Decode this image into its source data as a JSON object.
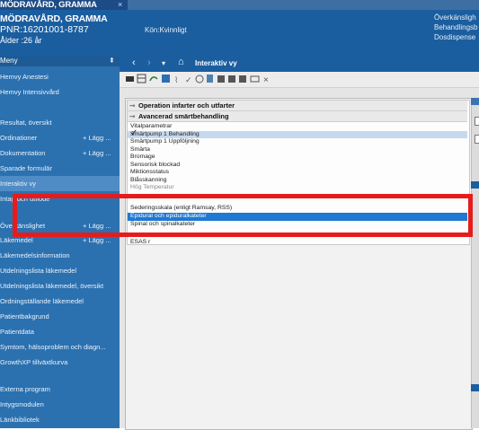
{
  "tab": {
    "title": "MÖDRAVÅRD, GRAMMA",
    "close": "×"
  },
  "patient": {
    "name": "MÖDRAVÅRD, GRAMMA",
    "pnr": "PNR:16201001-8787",
    "age": "Ålder :26 år",
    "gender": "Kön:Kvinnligt",
    "right_labels": [
      "Överkänsligh",
      "Behandlingsb",
      "Dosdispense"
    ]
  },
  "sidebar": {
    "title": "Meny",
    "pin": "⇞",
    "items": [
      {
        "label": "Hemvy Anestesi",
        "add": ""
      },
      {
        "label": "Hemvy Intensivvård",
        "add": ""
      },
      {
        "label": "",
        "add": ""
      },
      {
        "label": "Resultat, översikt",
        "add": ""
      },
      {
        "label": "Ordinationer",
        "add": "+ Lägg ..."
      },
      {
        "label": "Dokumentation",
        "add": "+ Lägg ..."
      },
      {
        "label": "Sparade formulär",
        "add": ""
      },
      {
        "label": "Interaktiv vy",
        "add": ""
      },
      {
        "label": "Intag och utflöde",
        "add": ""
      },
      {
        "label": "",
        "add": ""
      },
      {
        "label": "Överkänslighet",
        "add": "+ Lägg ..."
      },
      {
        "label": "Läkemedel",
        "add": "+ Lägg ..."
      },
      {
        "label": "Läkemedelsinformation",
        "add": ""
      },
      {
        "label": "Utdelningslista läkemedel",
        "add": ""
      },
      {
        "label": "Utdelningslista läkemedel, översikt",
        "add": ""
      },
      {
        "label": "Ordningställande läkemedel",
        "add": ""
      },
      {
        "label": "Patientbakgrund",
        "add": ""
      },
      {
        "label": "Patientdata",
        "add": ""
      },
      {
        "label": "Symtom, hälsoproblem och diagn...",
        "add": ""
      },
      {
        "label": "GrowthXP tillväxtkurva",
        "add": ""
      },
      {
        "label": "",
        "add": ""
      },
      {
        "label": "Externa program",
        "add": ""
      },
      {
        "label": "Intygsmodulen",
        "add": ""
      },
      {
        "label": "Länkbibliotek",
        "add": ""
      }
    ]
  },
  "nav": {
    "back": "‹",
    "forward": "›",
    "dropdown": "▾",
    "home": "⌂",
    "title": "Interaktiv vy"
  },
  "groups": [
    {
      "label": "Operation infarter och utfarter"
    },
    {
      "label": "Avancerad smärtbehandling"
    }
  ],
  "list": [
    {
      "label": "Vitalparametrar"
    },
    {
      "label": "Smärtpump 1 Behandling"
    },
    {
      "label": "Smärtpump 1 Uppföljning"
    },
    {
      "label": "Smärta"
    },
    {
      "label": "Bromage"
    },
    {
      "label": "Sensorisk blockad"
    },
    {
      "label": "Miktionsstatus"
    },
    {
      "label": "Blåsskanning"
    },
    {
      "label": "Hög Temperatur"
    },
    {
      "label": "Sederingsskala (enligt Ramsay, RSS)"
    },
    {
      "label": "Epidural och epiduralkateter"
    },
    {
      "label": "Spinal och spinalkateter"
    },
    {
      "label": "ESAS r"
    }
  ],
  "colors": {
    "accent": "#1b5e9f",
    "selection": "#1f78d1",
    "annotation": "#e61c1c"
  }
}
